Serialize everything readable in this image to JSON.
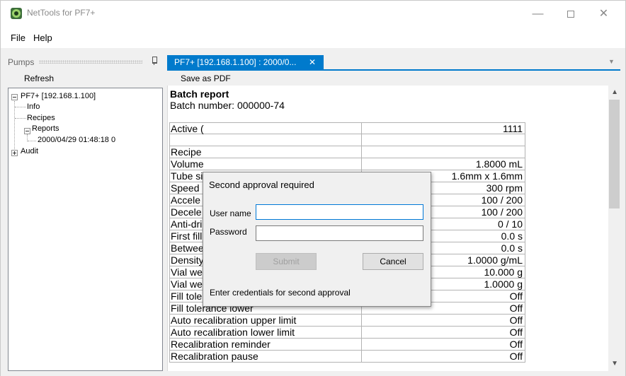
{
  "window": {
    "title": "NetTools for PF7+",
    "controls": {
      "minimize": "—",
      "maximize": "",
      "close": "✕"
    }
  },
  "menu": {
    "file": "File",
    "help": "Help"
  },
  "pumps_panel": {
    "title": "Pumps",
    "refresh": "Refresh",
    "tree": {
      "root": "PF7+ [192.168.1.100]",
      "info": "Info",
      "recipes": "Recipes",
      "reports": "Reports",
      "report_item": "2000/04/29 01:48:18 0",
      "audit": "Audit"
    }
  },
  "document": {
    "tab_label": "PF7+ [192.168.1.100] : 2000/0...",
    "tab_close": "✕",
    "tab_dropdown": "▼",
    "save_pdf": "Save as PDF",
    "report_title": "Batch report",
    "batch_number": "Batch number: 000000-74",
    "rows": [
      {
        "label": "Active (",
        "value": "1111"
      },
      {
        "label": "",
        "value": ""
      },
      {
        "label": "Recipe",
        "value": ""
      },
      {
        "label": "Volume",
        "value": "1.8000 mL"
      },
      {
        "label": "Tube si",
        "value": "1.6mm x 1.6mm"
      },
      {
        "label": "Speed",
        "value": "300 rpm"
      },
      {
        "label": "Accele",
        "value": "100 / 200"
      },
      {
        "label": "Decele",
        "value": "100 / 200"
      },
      {
        "label": "Anti-dri",
        "value": "0 / 10"
      },
      {
        "label": "First fill",
        "value": "0.0 s"
      },
      {
        "label": "Betwee",
        "value": "0.0 s"
      },
      {
        "label": "Density",
        "value": "1.0000 g/mL"
      },
      {
        "label": "Vial weight",
        "value": "10.000 g"
      },
      {
        "label": "Vial weight tolerance",
        "value": "1.0000 g"
      },
      {
        "label": "Fill tolerance upper",
        "value": "Off"
      },
      {
        "label": "Fill tolerance lower",
        "value": "Off"
      },
      {
        "label": "Auto recalibration upper limit",
        "value": "Off"
      },
      {
        "label": "Auto recalibration lower limit",
        "value": "Off"
      },
      {
        "label": "Recalibration reminder",
        "value": "Off"
      },
      {
        "label": "Recalibration pause",
        "value": "Off"
      }
    ],
    "scroll_up": "▲",
    "scroll_down": "▼"
  },
  "dialog": {
    "title": "Second approval required",
    "username_label": "User name",
    "username_value": "",
    "password_label": "Password",
    "password_value": "",
    "submit": "Submit",
    "cancel": "Cancel",
    "hint": "Enter credentials for second approval"
  },
  "colors": {
    "accent": "#007acc",
    "window_background": "#f0f0f0",
    "focus_border": "#0078d7"
  }
}
